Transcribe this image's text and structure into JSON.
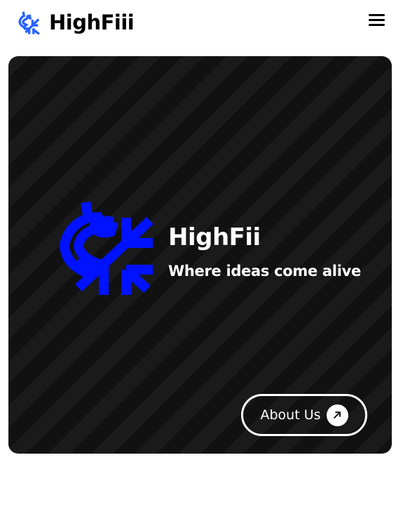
{
  "header": {
    "brand_name": "HighFiii",
    "logo_icon": "highfii-logo-icon",
    "menu_icon": "hamburger-menu-icon",
    "brand_color": "#2962ff"
  },
  "hero": {
    "logo_icon": "highfii-logo-icon",
    "logo_color": "#0012ff",
    "title": "HighFii",
    "tagline": "Where ideas come alive",
    "about_button": {
      "label": "About Us",
      "icon": "arrow-up-right-icon"
    },
    "background_color": "#151515"
  }
}
